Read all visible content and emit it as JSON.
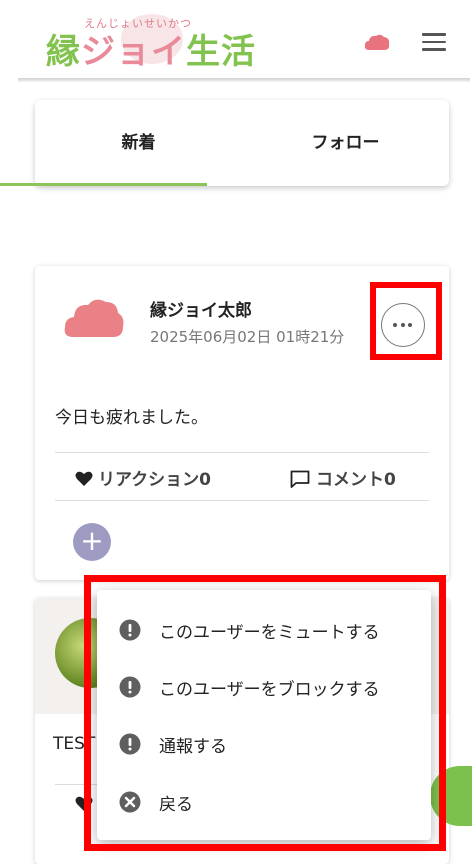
{
  "header": {
    "logo_text_green": "縁",
    "logo_text_pink": "ジョイ",
    "logo_text_green2": "生活",
    "logo_ruby": "えんじょいせいかつ",
    "cloud_icon": "cloud-icon",
    "menu_icon": "hamburger-menu-icon"
  },
  "tabs": [
    {
      "label": "新着",
      "active": true
    },
    {
      "label": "フォロー",
      "active": false
    }
  ],
  "post": {
    "user_name": "縁ジョイ太郎",
    "date": "2025年06月02日 01時21分",
    "body": "今日も疲れました。",
    "reaction_label": "リアクション0",
    "comment_label": "コメント0",
    "add_label": "+"
  },
  "post2": {
    "body": "TEST"
  },
  "menu": {
    "items": [
      {
        "label": "このユーザーをミュートする",
        "icon": "alert-icon"
      },
      {
        "label": "このユーザーをブロックする",
        "icon": "alert-icon"
      },
      {
        "label": "通報する",
        "icon": "alert-icon"
      },
      {
        "label": "戻る",
        "icon": "close-icon"
      }
    ]
  },
  "colors": {
    "accent_green": "#8cc45a",
    "logo_pink": "#e98a99",
    "icon_gray": "#555555",
    "highlight_red": "#ff0000",
    "add_button": "#9e9bc3"
  }
}
